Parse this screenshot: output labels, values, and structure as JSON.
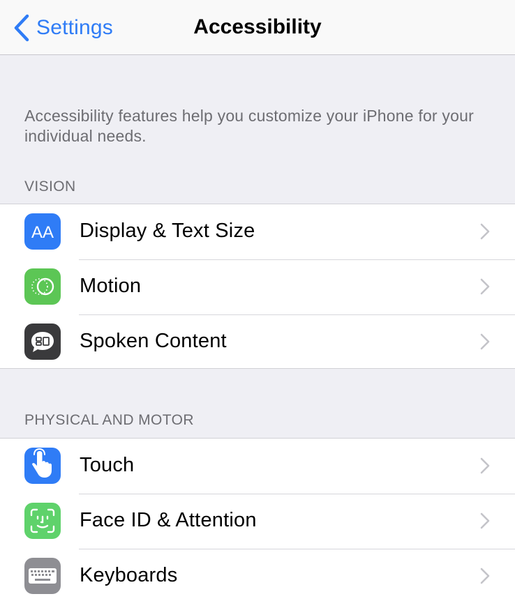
{
  "navbar": {
    "back_label": "Settings",
    "title": "Accessibility"
  },
  "description": "Accessibility features help you customize your iPhone for your individual needs.",
  "sections": [
    {
      "header": "VISION",
      "items": [
        {
          "label": "Display & Text Size",
          "icon": "text-size-icon",
          "icon_text": "AA",
          "color": "#2f7cf6"
        },
        {
          "label": "Motion",
          "icon": "motion-icon",
          "color": "#5cc655"
        },
        {
          "label": "Spoken Content",
          "icon": "speech-bubble-icon",
          "color": "#3a3a3c"
        }
      ]
    },
    {
      "header": "PHYSICAL AND MOTOR",
      "items": [
        {
          "label": "Touch",
          "icon": "hand-pointer-icon",
          "color": "#2f7cf6"
        },
        {
          "label": "Face ID & Attention",
          "icon": "face-id-icon",
          "color": "#5fd26b"
        },
        {
          "label": "Keyboards",
          "icon": "keyboard-icon",
          "color": "#8e8e93"
        }
      ]
    }
  ],
  "colors": {
    "accent": "#2f7cf6",
    "background": "#efeff4",
    "secondary_text": "#6d6d72",
    "chevron": "#c4c4c9"
  }
}
